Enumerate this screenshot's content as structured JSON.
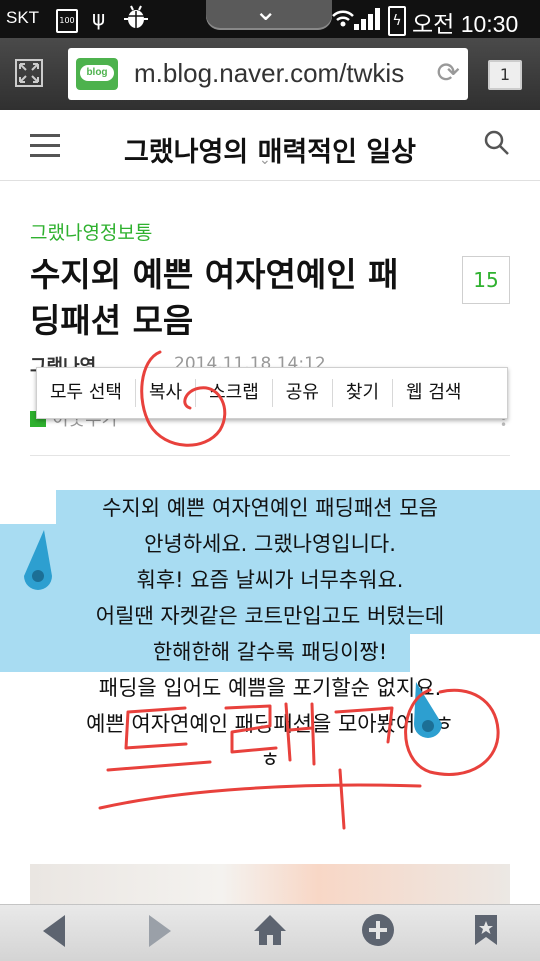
{
  "status_bar": {
    "carrier": "SKT",
    "battery_level": "100",
    "usb_icon": "usb-icon",
    "debug_icon": "android-debug-icon",
    "time": "오전 10:30"
  },
  "browser": {
    "url": "m.blog.naver.com/twkis",
    "logo_text": "blog",
    "tab_count": "1"
  },
  "blog_header": {
    "title": "그랬나영의 매력적인 일상"
  },
  "post": {
    "category": "그랬나영정보통",
    "title_line1": "수지외 예쁜 여자연예인 패",
    "title_line2": "딩패션 모음",
    "comment_count": "15",
    "author": "그랬나영",
    "date": "2014.11.18 14:12",
    "add_neighbor": "이웃추가",
    "body_lines": [
      "수지외 예쁜 여자연예인 패딩패션 모음",
      "안녕하세요. 그랬나영입니다.",
      "훠후! 요즘 날씨가 너무추워요.",
      "어릴땐 자켓같은 코트만입고도 버텼는데",
      "한해한해 갈수록 패딩이짱!",
      "패딩을 입어도 예쁨을 포기할순 없지요.",
      "예쁜 여자연예인 패딩패션을 모아봤어용ㅎ",
      "ㅎ"
    ]
  },
  "context_menu": {
    "items": [
      "모두 선택",
      "복사",
      "스크랩",
      "공유",
      "찾기",
      "웹 검색"
    ]
  },
  "annotation": {
    "handwritten_text": "드래그",
    "color": "#e8413c"
  },
  "colors": {
    "accent_green": "#2fb12f",
    "selection": "#a8dcf2",
    "handle_blue": "#2d9fd0"
  }
}
